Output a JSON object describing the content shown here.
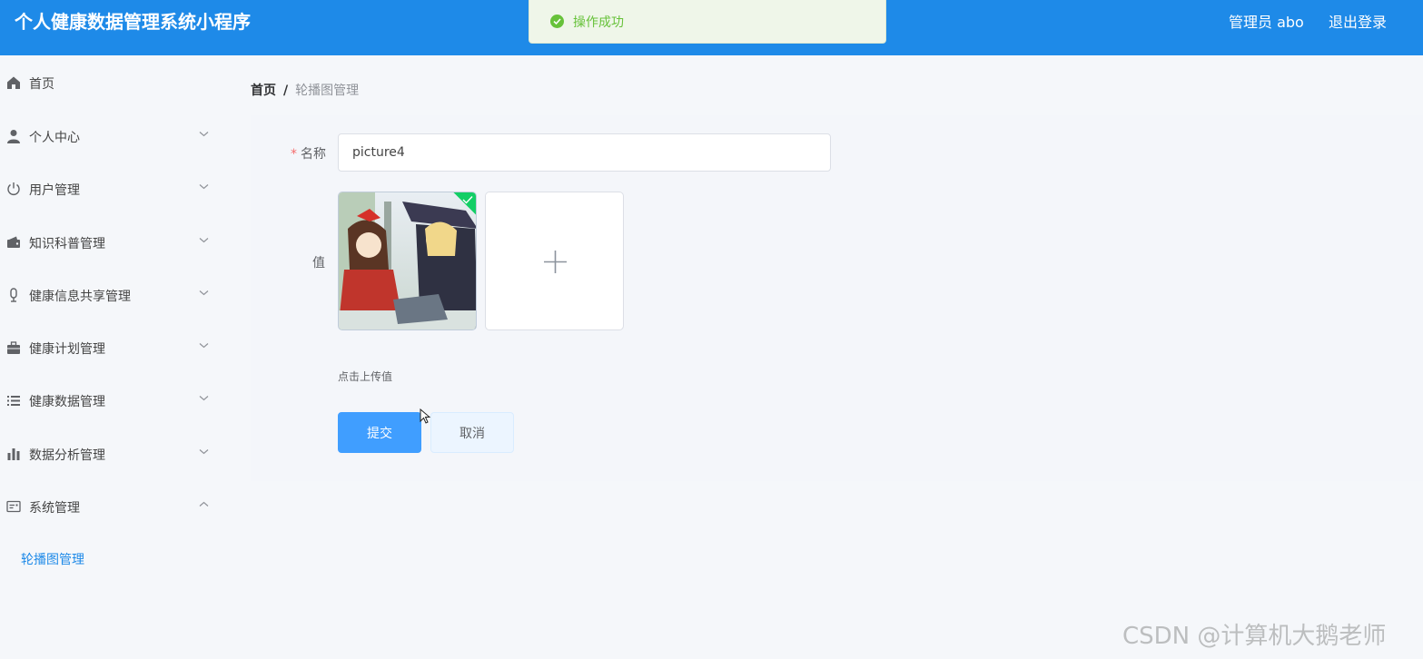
{
  "header": {
    "title": "个人健康数据管理系统小程序",
    "user_label": "管理员 abo",
    "logout_label": "退出登录",
    "bg_color": "#1e8ae8"
  },
  "toast": {
    "icon": "check-circle-icon",
    "text": "操作成功",
    "color": "#67c23a"
  },
  "sidebar": {
    "items": [
      {
        "label": "首页",
        "icon": "home-icon",
        "has_chevron": false
      },
      {
        "label": "个人中心",
        "icon": "user-icon",
        "has_chevron": true
      },
      {
        "label": "用户管理",
        "icon": "power-icon",
        "has_chevron": true
      },
      {
        "label": "知识科普管理",
        "icon": "wallet-icon",
        "has_chevron": true
      },
      {
        "label": "健康信息共享管理",
        "icon": "microphone-icon",
        "has_chevron": true
      },
      {
        "label": "健康计划管理",
        "icon": "briefcase-icon",
        "has_chevron": true
      },
      {
        "label": "健康数据管理",
        "icon": "list-icon",
        "has_chevron": true
      },
      {
        "label": "数据分析管理",
        "icon": "bar-chart-icon",
        "has_chevron": true
      },
      {
        "label": "系统管理",
        "icon": "id-card-icon",
        "has_chevron": true,
        "expanded": true
      }
    ],
    "submenu": [
      {
        "label": "轮播图管理",
        "active": true
      }
    ],
    "active_color": "#1e8ae8"
  },
  "breadcrumb": {
    "home": "首页",
    "separator": "/",
    "current": "轮播图管理"
  },
  "form": {
    "name_label": "名称",
    "required_mark": "*",
    "name_value": "picture4",
    "value_label": "值",
    "upload_hint": "点击上传值",
    "submit_label": "提交",
    "cancel_label": "取消"
  },
  "watermark": "CSDN @计算机大鹅老师"
}
